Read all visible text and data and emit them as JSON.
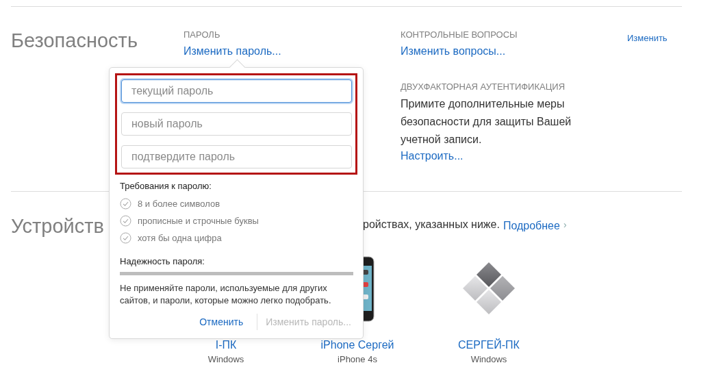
{
  "security": {
    "title": "Безопасность",
    "password": {
      "label": "ПАРОЛЬ",
      "link": "Изменить пароль..."
    },
    "questions": {
      "label": "КОНТРОЛЬНЫЕ ВОПРОСЫ",
      "link": "Изменить вопросы..."
    },
    "two_factor": {
      "label": "ДВУХФАКТОРНАЯ АУТЕНТИФИКАЦИЯ",
      "text": "Примите дополнительные меры безопасности для защиты Вашей учетной записи.",
      "link": "Настроить..."
    },
    "edit_link": "Изменить"
  },
  "devices": {
    "title": "Устройств",
    "intro": "ройствах, указанных ниже.",
    "more_link": "Подробнее",
    "more_chevron": "›",
    "items": [
      {
        "name": "I-ПК",
        "os": "Windows",
        "kind": "hidden"
      },
      {
        "name": "iPhone Сергей",
        "os": "iPhone 4s",
        "kind": "phone"
      },
      {
        "name": "СЕРГЕЙ-ПК",
        "os": "Windows",
        "kind": "windows"
      }
    ]
  },
  "popover": {
    "highlighted": true,
    "fields": [
      {
        "placeholder": "текущий пароль",
        "focused": true
      },
      {
        "placeholder": "новый пароль",
        "focused": false
      },
      {
        "placeholder": "подтвердите пароль",
        "focused": false
      }
    ],
    "requirements_title": "Требования к паролю:",
    "requirements": [
      {
        "text": "8 и более символов",
        "met": false
      },
      {
        "text": "прописные и строчные буквы",
        "met": false
      },
      {
        "text": "хотя бы одна цифра",
        "met": false
      }
    ],
    "strength_label": "Надежность пароля:",
    "strength": {
      "level": 0
    },
    "warning": "Не применяйте пароли, используемые для других сайтов, и пароли, которые можно легко подобрать.",
    "buttons": [
      {
        "label": "Отменить",
        "disabled": false
      },
      {
        "label": "Изменить пароль...",
        "disabled": true
      }
    ]
  }
}
